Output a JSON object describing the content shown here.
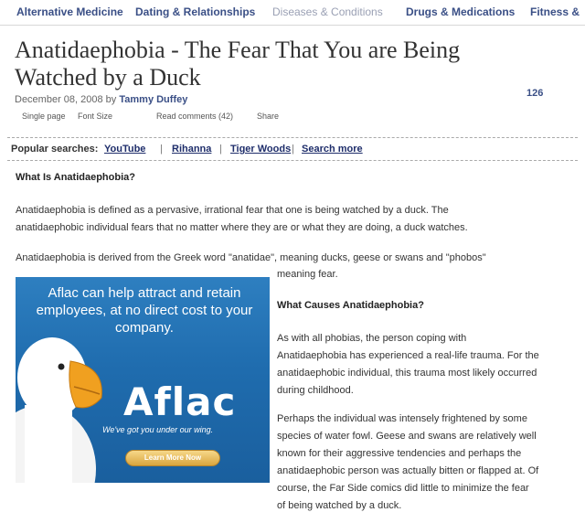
{
  "nav": {
    "items": [
      {
        "label": "Alternative Medicine"
      },
      {
        "label": "Dating & Relationships"
      },
      {
        "label": "Diseases & Conditions"
      },
      {
        "label": "Drugs & Medications"
      },
      {
        "label": "Fitness &"
      }
    ]
  },
  "article": {
    "title": "Anatidaephobia - The Fear That You are Being Watched by a Duck",
    "date": "December 08, 2008 by",
    "author": "Tammy Duffey",
    "count": "126",
    "tools": {
      "single_page": "Single page",
      "font_size": "Font Size",
      "read_comments": "Read comments (42)",
      "share": "Share"
    }
  },
  "popular": {
    "label": "Popular searches:",
    "links": [
      "YouTube",
      "Rihanna",
      "Tiger Woods",
      "Search more"
    ],
    "separator": "|"
  },
  "content": {
    "h1": "What Is Anatidaephobia?",
    "p1_line1": "Anatidaephobia is defined as a pervasive, irrational fear that one is being watched by a duck. The",
    "p1_line2": "anatidaephobic individual fears that no matter where they are or what they are doing, a duck watches.",
    "p2_line1": "Anatidaephobia is derived from the Greek word \"anatidae\", meaning ducks, geese or swans and \"phobos\"",
    "p2_line2": "meaning fear.",
    "h2": "What Causes Anatidaephobia?",
    "p3": [
      "As with all phobias, the person coping with",
      "Anatidaephobia has experienced a real-life trauma. For the",
      "anatidaephobic individual, this trauma most likely occurred",
      "during childhood."
    ],
    "p4": [
      "Perhaps the individual was intensely frightened by some",
      "species of water fowl. Geese and swans are relatively well",
      "known for their aggressive tendencies and perhaps the",
      "anatidaephobic person was actually bitten or flapped at. Of",
      "course, the Far Side comics did little to minimize the fear",
      "of being watched by a duck."
    ]
  },
  "ad": {
    "headline_1": "Aflac can help attract and retain",
    "headline_2": "employees, at no direct cost to your",
    "headline_3": "company.",
    "logo": "Aflac",
    "tagline": "We've got you under our wing.",
    "button": "Learn More Now"
  },
  "colors": {
    "link": "#3a4f86",
    "ad_blue": "#1f6cae"
  }
}
